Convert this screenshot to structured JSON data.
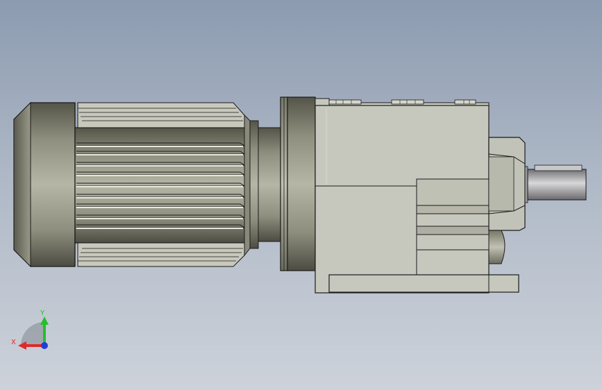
{
  "viewport": {
    "background_top": "#8c9bb0",
    "background_bottom": "#cdd2da"
  },
  "triad": {
    "x_label": "X",
    "y_label": "Y",
    "x_color": "#e0282a",
    "y_color": "#22c02a",
    "z_color": "#1f3fd6"
  },
  "model": {
    "motor_color": "#a6a693",
    "gearbox_color": "#c7c8bd",
    "edge_color": "#1a1a1a"
  }
}
